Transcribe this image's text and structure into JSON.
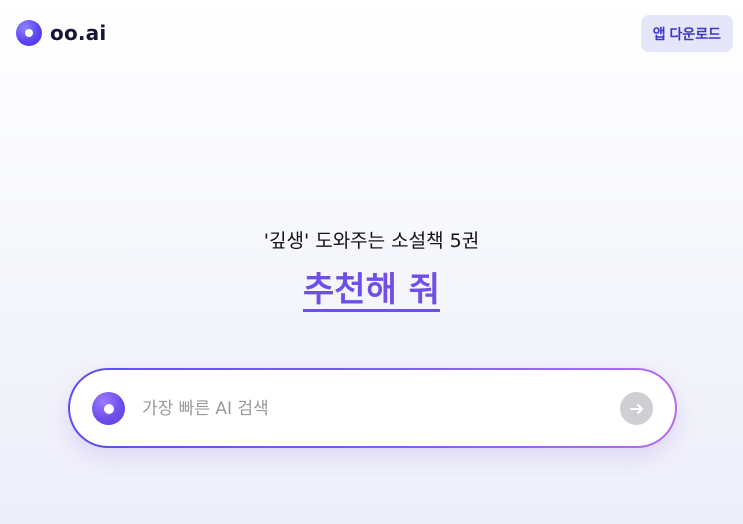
{
  "header": {
    "logo_text": "oo.ai",
    "download_button": "앱 다운로드"
  },
  "hero": {
    "suggestion_line": "'깊생' 도와주는 소설책 5권",
    "suggestion_link": "추천해 줘"
  },
  "search": {
    "placeholder": "가장 빠른 AI 검색",
    "value": ""
  },
  "colors": {
    "accent": "#6f4ee9",
    "brand": "#5b45f5",
    "download_bg": "#e6e6fb",
    "submit_disabled": "#cfcfd3"
  },
  "icons": {
    "logo": "oo-logo-icon",
    "search": "oo-circle-icon",
    "submit": "arrow-right-icon"
  }
}
